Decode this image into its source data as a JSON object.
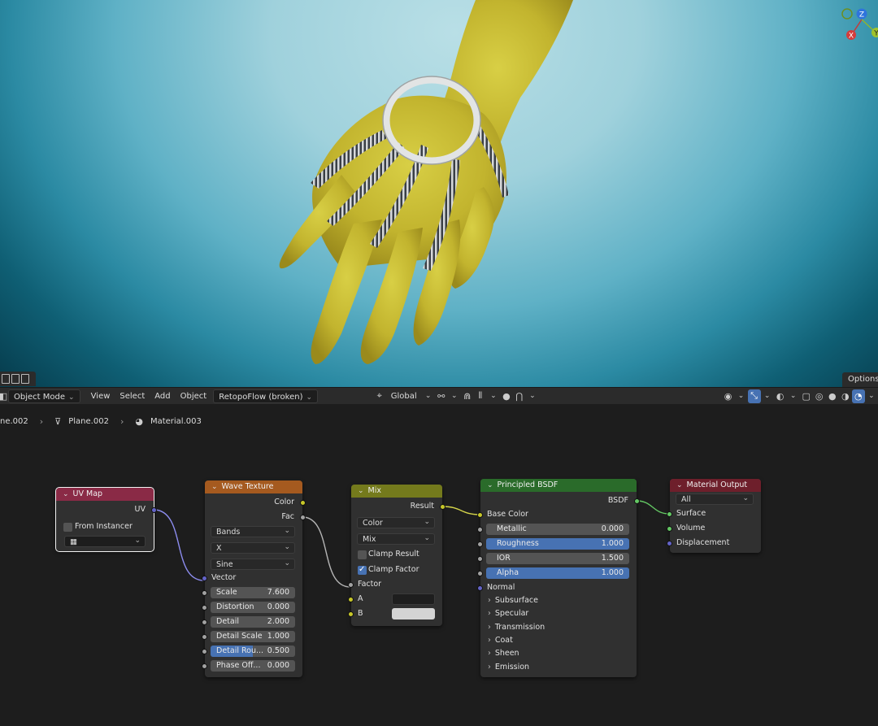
{
  "viewport": {
    "options_label": "Options",
    "gizmo": {
      "x": "X",
      "y": "Y",
      "z": "Z"
    }
  },
  "toolbar": {
    "mode": "Object Mode",
    "menus": [
      "View",
      "Select",
      "Add",
      "Object"
    ],
    "addon_menu": "RetopoFlow (broken)",
    "transform_orientation": "Global",
    "icons": [
      "transform-pivot-icon",
      "snap-icon",
      "snap-target-icon",
      "proportional-edit-icon",
      "falloff-icon",
      "visibility-icon",
      "gizmo-icon",
      "overlay-icon",
      "xray-icon",
      "wireframe-shading-icon",
      "solid-shading-icon",
      "material-shading-icon",
      "rendered-shading-icon"
    ]
  },
  "breadcrumb": {
    "object": "ne.002",
    "mesh": "Plane.002",
    "material": "Material.003"
  },
  "nodes": {
    "uv_map": {
      "title": "UV Map",
      "header_color": "#8a2a46",
      "output": "UV",
      "from_instancer": "From Instancer",
      "uv_field": ""
    },
    "wave_texture": {
      "title": "Wave Texture",
      "header_color": "#a55a1f",
      "outputs": [
        "Color",
        "Fac"
      ],
      "wave_type": "Bands",
      "direction": "X",
      "profile": "Sine",
      "vector_input": "Vector",
      "params": [
        {
          "label": "Scale",
          "value": "7.600"
        },
        {
          "label": "Distortion",
          "value": "0.000"
        },
        {
          "label": "Detail",
          "value": "2.000"
        },
        {
          "label": "Detail Scale",
          "value": "1.000"
        },
        {
          "label": "Detail Rou...",
          "value": "0.500"
        },
        {
          "label": "Phase Off...",
          "value": "0.000"
        }
      ]
    },
    "mix": {
      "title": "Mix",
      "header_color": "#747a1c",
      "output": "Result",
      "data_type": "Color",
      "blend_mode": "Mix",
      "clamp_result": "Clamp Result",
      "clamp_factor": "Clamp Factor",
      "clamp_result_checked": false,
      "clamp_factor_checked": true,
      "inputs": [
        "Factor",
        "A",
        "B"
      ],
      "a_color": "#1e1e1e",
      "b_color": "#d4d4d4"
    },
    "principled": {
      "title": "Principled BSDF",
      "header_color": "#2a6b2a",
      "output": "BSDF",
      "base_color": "Base Color",
      "params": [
        {
          "label": "Metallic",
          "value": "0.000"
        },
        {
          "label": "Roughness",
          "value": "1.000"
        },
        {
          "label": "IOR",
          "value": "1.500"
        },
        {
          "label": "Alpha",
          "value": "1.000"
        }
      ],
      "normal": "Normal",
      "panels": [
        "Subsurface",
        "Specular",
        "Transmission",
        "Coat",
        "Sheen",
        "Emission"
      ]
    },
    "material_output": {
      "title": "Material Output",
      "header_color": "#6e1f2b",
      "target": "All",
      "inputs": [
        "Surface",
        "Volume",
        "Displacement"
      ]
    }
  }
}
